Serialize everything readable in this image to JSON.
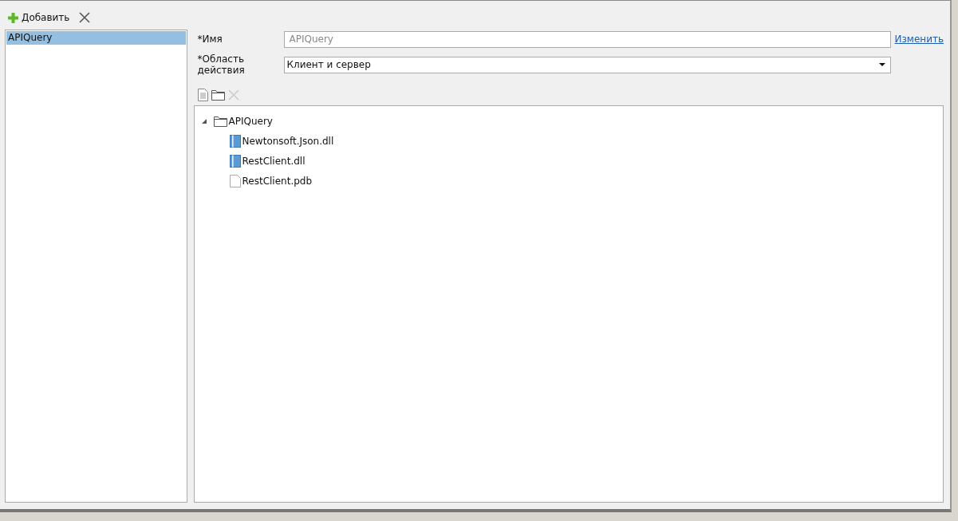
{
  "toolbar": {
    "add_label": "Добавить"
  },
  "list": {
    "items": [
      {
        "label": "APIQuery",
        "selected": true
      }
    ]
  },
  "form": {
    "name_label": "*Имя",
    "name_placeholder": "APIQuery",
    "change_link": "Изменить",
    "scope_label": "*Область действия",
    "scope_value": "Клиент и сервер"
  },
  "tree": [
    {
      "label": "APIQuery",
      "kind": "folder",
      "expanded": true,
      "children": [
        {
          "label": "Newtonsoft.Json.dll",
          "kind": "library"
        },
        {
          "label": "RestClient.dll",
          "kind": "library"
        },
        {
          "label": "RestClient.pdb",
          "kind": "file"
        }
      ]
    }
  ]
}
